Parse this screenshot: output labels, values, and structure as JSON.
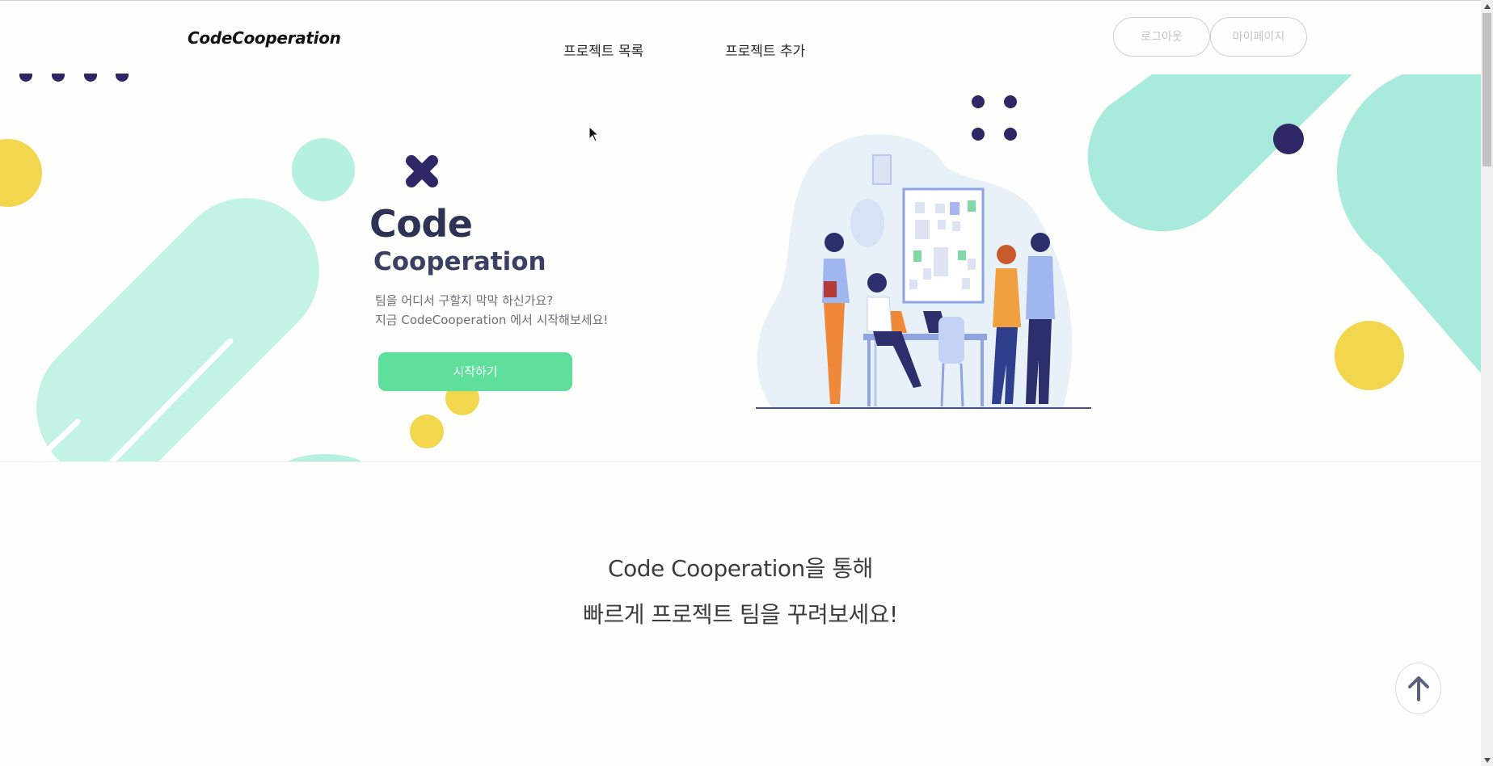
{
  "header": {
    "logo": "CodeCooperation",
    "nav": {
      "project_list": "프로젝트 목록",
      "project_add": "프로젝트 추가"
    },
    "logout_label": "로그아웃",
    "mypage_label": "마이페이지"
  },
  "hero": {
    "title_line1": "Code",
    "title_line2": "Cooperation",
    "desc_line1": "팀을 어디서 구할지 막막 하신가요?",
    "desc_line2": "지금 CodeCooperation 에서 시작해보세요!",
    "start_label": "시작하기"
  },
  "intro": {
    "line1": "Code Cooperation을 통해",
    "line2": "빠르게 프로젝트 팀을 꾸려보세요!"
  },
  "colors": {
    "mint": "#a8eadb",
    "mint_light": "#c2f3e5",
    "navy": "#2d2766",
    "yellow": "#f2d64e",
    "start_button": "#5ee09c"
  },
  "icons": {
    "scroll_top": "arrow-up-icon",
    "decor_x": "x-mark-icon"
  }
}
